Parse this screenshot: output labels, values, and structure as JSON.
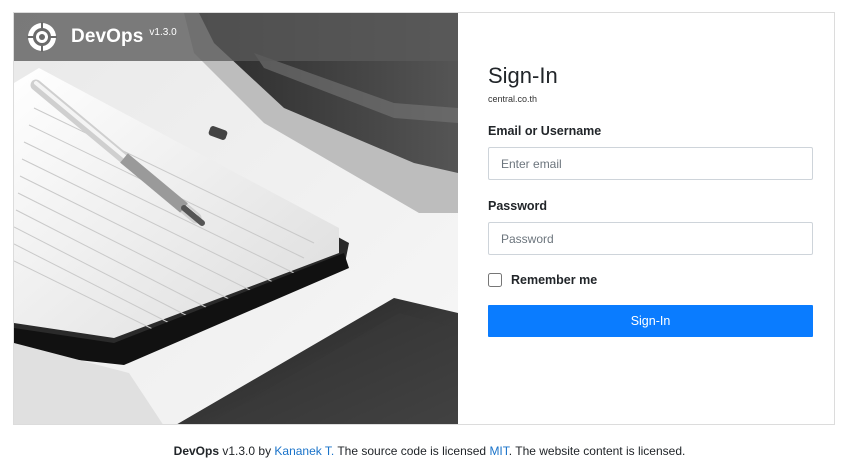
{
  "brand": {
    "name": "DevOps",
    "version": "v1.3.0",
    "logo_icon": "target-gear-icon"
  },
  "form": {
    "title": "Sign-In",
    "domain": "central.co.th",
    "email_label": "Email or Username",
    "email_placeholder": "Enter email",
    "email_value": "",
    "password_label": "Password",
    "password_placeholder": "Password",
    "password_value": "",
    "remember_label": "Remember me",
    "remember_checked": false,
    "submit_label": "Sign-In"
  },
  "footer": {
    "product": "DevOps",
    "version_by": " v1.3.0 by ",
    "author_link": "Kananek T.",
    "mid_text": " The source code is licensed ",
    "license_link": "MIT",
    "end_text": ". The website content is licensed."
  },
  "colors": {
    "primary": "#0a7cff",
    "link": "#1a73c9",
    "brandbar": "#5a5a5a"
  }
}
